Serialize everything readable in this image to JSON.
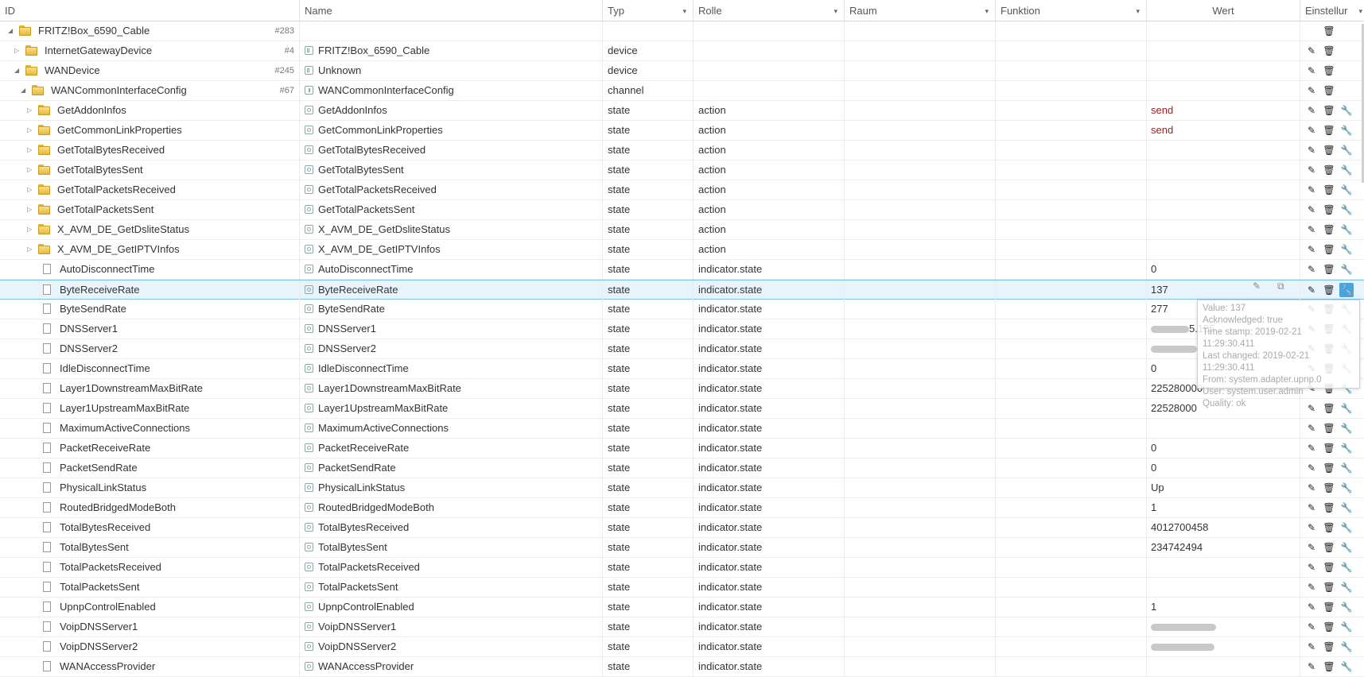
{
  "headers": {
    "id": "ID",
    "name": "Name",
    "typ": "Typ",
    "rolle": "Rolle",
    "raum": "Raum",
    "funktion": "Funktion",
    "wert": "Wert",
    "einstellungen": "Einstellur"
  },
  "icons": {
    "sort": "▾",
    "expanded": "◢",
    "collapsed": "▷",
    "edit": "✎",
    "delete": "🗑",
    "wrench": "🔧",
    "copy": "⧉"
  },
  "rows": [
    {
      "id": "FRITZ!Box_6590_Cable",
      "count": "#283",
      "level": 0,
      "kind": "folder",
      "tw": "expanded",
      "name": "",
      "typ": "",
      "rolle": "",
      "wert": "",
      "btns": "d"
    },
    {
      "id": "InternetGatewayDevice",
      "count": "#4",
      "level": 1,
      "kind": "folder",
      "tw": "collapsed",
      "name": "FRITZ!Box_6590_Cable",
      "ni": "dev",
      "typ": "device",
      "rolle": "",
      "wert": "",
      "btns": "ed"
    },
    {
      "id": "WANDevice",
      "count": "#245",
      "level": 1,
      "kind": "folder",
      "tw": "expanded",
      "name": "Unknown",
      "ni": "dev",
      "typ": "device",
      "rolle": "",
      "wert": "",
      "btns": "ed"
    },
    {
      "id": "WANCommonInterfaceConfig",
      "count": "#67",
      "level": 2,
      "kind": "folder",
      "tw": "expanded",
      "name": "WANCommonInterfaceConfig",
      "ni": "chan",
      "typ": "channel",
      "rolle": "",
      "wert": "",
      "btns": "ed"
    },
    {
      "id": "GetAddonInfos",
      "count": "",
      "level": 3,
      "kind": "folder",
      "tw": "collapsed",
      "name": "GetAddonInfos",
      "ni": "state",
      "typ": "state",
      "rolle": "action",
      "wert": "send",
      "send": true,
      "btns": "edw"
    },
    {
      "id": "GetCommonLinkProperties",
      "count": "",
      "level": 3,
      "kind": "folder",
      "tw": "collapsed",
      "name": "GetCommonLinkProperties",
      "ni": "state",
      "typ": "state",
      "rolle": "action",
      "wert": "send",
      "send": true,
      "btns": "edw"
    },
    {
      "id": "GetTotalBytesReceived",
      "count": "",
      "level": 3,
      "kind": "folder",
      "tw": "collapsed",
      "name": "GetTotalBytesReceived",
      "ni": "state",
      "typ": "state",
      "rolle": "action",
      "wert": "",
      "btns": "edw"
    },
    {
      "id": "GetTotalBytesSent",
      "count": "",
      "level": 3,
      "kind": "folder",
      "tw": "collapsed",
      "name": "GetTotalBytesSent",
      "ni": "state",
      "typ": "state",
      "rolle": "action",
      "wert": "",
      "btns": "edw"
    },
    {
      "id": "GetTotalPacketsReceived",
      "count": "",
      "level": 3,
      "kind": "folder",
      "tw": "collapsed",
      "name": "GetTotalPacketsReceived",
      "ni": "state",
      "typ": "state",
      "rolle": "action",
      "wert": "",
      "btns": "edw"
    },
    {
      "id": "GetTotalPacketsSent",
      "count": "",
      "level": 3,
      "kind": "folder",
      "tw": "collapsed",
      "name": "GetTotalPacketsSent",
      "ni": "state",
      "typ": "state",
      "rolle": "action",
      "wert": "",
      "btns": "edw"
    },
    {
      "id": "X_AVM_DE_GetDsliteStatus",
      "count": "",
      "level": 3,
      "kind": "folder",
      "tw": "collapsed",
      "name": "X_AVM_DE_GetDsliteStatus",
      "ni": "state",
      "typ": "state",
      "rolle": "action",
      "wert": "",
      "btns": "edw"
    },
    {
      "id": "X_AVM_DE_GetIPTVInfos",
      "count": "",
      "level": 3,
      "kind": "folder",
      "tw": "collapsed",
      "name": "X_AVM_DE_GetIPTVInfos",
      "ni": "state",
      "typ": "state",
      "rolle": "action",
      "wert": "",
      "btns": "edw"
    },
    {
      "id": "AutoDisconnectTime",
      "count": "",
      "level": 3,
      "kind": "file",
      "name": "AutoDisconnectTime",
      "ni": "state",
      "typ": "state",
      "rolle": "indicator.state",
      "wert": "0",
      "btns": "edw"
    },
    {
      "id": "ByteReceiveRate",
      "count": "",
      "level": 3,
      "kind": "file",
      "name": "ByteReceiveRate",
      "ni": "state",
      "typ": "state",
      "rolle": "indicator.state",
      "wert": "137",
      "btns": "edw",
      "selected": true
    },
    {
      "id": "ByteSendRate",
      "count": "",
      "level": 3,
      "kind": "file",
      "name": "ByteSendRate",
      "ni": "state",
      "typ": "state",
      "rolle": "indicator.state",
      "wert": "277",
      "btns": "edw"
    },
    {
      "id": "DNSServer1",
      "count": "",
      "level": 3,
      "kind": "file",
      "name": "DNSServer1",
      "ni": "state",
      "typ": "state",
      "rolle": "indicator.state",
      "wert": "5.155",
      "blur": 1,
      "btns": "edw"
    },
    {
      "id": "DNSServer2",
      "count": "",
      "level": 3,
      "kind": "file",
      "name": "DNSServer2",
      "ni": "state",
      "typ": "state",
      "rolle": "indicator.state",
      "wert": "",
      "blur": 2,
      "btns": "edw"
    },
    {
      "id": "IdleDisconnectTime",
      "count": "",
      "level": 3,
      "kind": "file",
      "name": "IdleDisconnectTime",
      "ni": "state",
      "typ": "state",
      "rolle": "indicator.state",
      "wert": "0",
      "btns": "edw"
    },
    {
      "id": "Layer1DownstreamMaxBitRate",
      "count": "",
      "level": 3,
      "kind": "file",
      "name": "Layer1DownstreamMaxBitRate",
      "ni": "state",
      "typ": "state",
      "rolle": "indicator.state",
      "wert": "225280000",
      "btns": "edw"
    },
    {
      "id": "Layer1UpstreamMaxBitRate",
      "count": "",
      "level": 3,
      "kind": "file",
      "name": "Layer1UpstreamMaxBitRate",
      "ni": "state",
      "typ": "state",
      "rolle": "indicator.state",
      "wert": "22528000",
      "btns": "edw"
    },
    {
      "id": "MaximumActiveConnections",
      "count": "",
      "level": 3,
      "kind": "file",
      "name": "MaximumActiveConnections",
      "ni": "state",
      "typ": "state",
      "rolle": "indicator.state",
      "wert": "",
      "btns": "edw"
    },
    {
      "id": "PacketReceiveRate",
      "count": "",
      "level": 3,
      "kind": "file",
      "name": "PacketReceiveRate",
      "ni": "state",
      "typ": "state",
      "rolle": "indicator.state",
      "wert": "0",
      "btns": "edw"
    },
    {
      "id": "PacketSendRate",
      "count": "",
      "level": 3,
      "kind": "file",
      "name": "PacketSendRate",
      "ni": "state",
      "typ": "state",
      "rolle": "indicator.state",
      "wert": "0",
      "btns": "edw"
    },
    {
      "id": "PhysicalLinkStatus",
      "count": "",
      "level": 3,
      "kind": "file",
      "name": "PhysicalLinkStatus",
      "ni": "state",
      "typ": "state",
      "rolle": "indicator.state",
      "wert": "Up",
      "btns": "edw"
    },
    {
      "id": "RoutedBridgedModeBoth",
      "count": "",
      "level": 3,
      "kind": "file",
      "name": "RoutedBridgedModeBoth",
      "ni": "state",
      "typ": "state",
      "rolle": "indicator.state",
      "wert": "1",
      "btns": "edw"
    },
    {
      "id": "TotalBytesReceived",
      "count": "",
      "level": 3,
      "kind": "file",
      "name": "TotalBytesReceived",
      "ni": "state",
      "typ": "state",
      "rolle": "indicator.state",
      "wert": "4012700458",
      "btns": "edw"
    },
    {
      "id": "TotalBytesSent",
      "count": "",
      "level": 3,
      "kind": "file",
      "name": "TotalBytesSent",
      "ni": "state",
      "typ": "state",
      "rolle": "indicator.state",
      "wert": "234742494",
      "btns": "edw"
    },
    {
      "id": "TotalPacketsReceived",
      "count": "",
      "level": 3,
      "kind": "file",
      "name": "TotalPacketsReceived",
      "ni": "state",
      "typ": "state",
      "rolle": "indicator.state",
      "wert": "",
      "btns": "edw"
    },
    {
      "id": "TotalPacketsSent",
      "count": "",
      "level": 3,
      "kind": "file",
      "name": "TotalPacketsSent",
      "ni": "state",
      "typ": "state",
      "rolle": "indicator.state",
      "wert": "",
      "btns": "edw"
    },
    {
      "id": "UpnpControlEnabled",
      "count": "",
      "level": 3,
      "kind": "file",
      "name": "UpnpControlEnabled",
      "ni": "state",
      "typ": "state",
      "rolle": "indicator.state",
      "wert": "1",
      "btns": "edw"
    },
    {
      "id": "VoipDNSServer1",
      "count": "",
      "level": 3,
      "kind": "file",
      "name": "VoipDNSServer1",
      "ni": "state",
      "typ": "state",
      "rolle": "indicator.state",
      "wert": "",
      "blur": 3,
      "btns": "edw"
    },
    {
      "id": "VoipDNSServer2",
      "count": "",
      "level": 3,
      "kind": "file",
      "name": "VoipDNSServer2",
      "ni": "state",
      "typ": "state",
      "rolle": "indicator.state",
      "wert": "",
      "blur": 4,
      "btns": "edw"
    },
    {
      "id": "WANAccessProvider",
      "count": "",
      "level": 3,
      "kind": "file",
      "name": "WANAccessProvider",
      "ni": "state",
      "typ": "state",
      "rolle": "indicator.state",
      "wert": "",
      "btns": "edw"
    }
  ],
  "tooltip": {
    "lines": [
      "Value: 137",
      "Acknowledged: true",
      "Time stamp: 2019-02-21 11:29:30.411",
      "Last changed: 2019-02-21 11:29:30.411",
      "From: system.adapter.upnp.0",
      "User: system.user.admin",
      "Quality: ok"
    ]
  }
}
